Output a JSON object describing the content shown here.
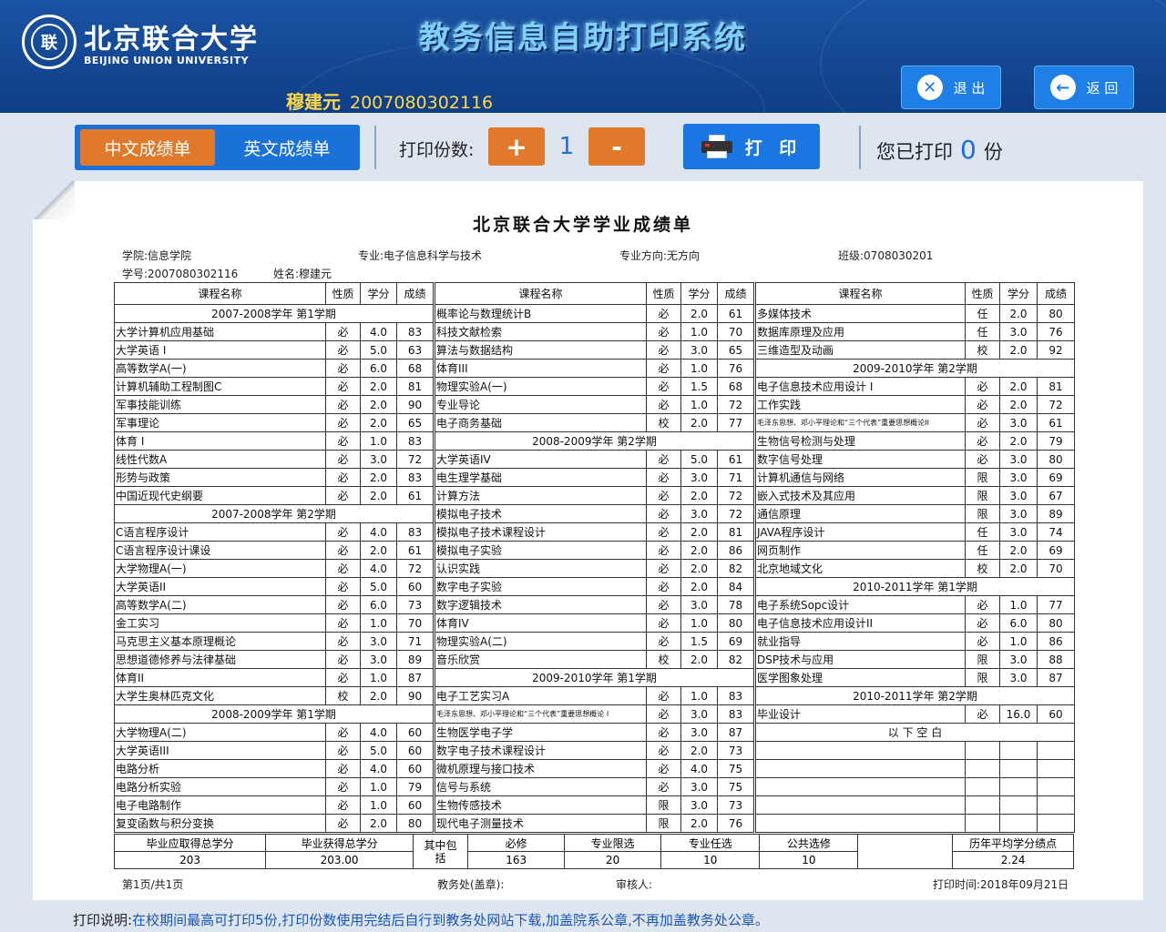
{
  "header": {
    "logo_cn": "北京联合大学",
    "logo_en": "BEIJING UNION UNIVERSITY",
    "system_title": "教务信息自助打印系统",
    "user_name": "穆建元",
    "user_id": "2007080302116",
    "exit_label": "退 出",
    "back_label": "返 回"
  },
  "toolbar": {
    "tab_cn": "中文成绩单",
    "tab_en": "英文成绩单",
    "copies_label": "打印份数:",
    "plus_label": "+",
    "minus_label": "-",
    "copies_value": "1",
    "print_label": "打 印",
    "printed_prefix": "您已打印",
    "printed_count": "0",
    "printed_suffix": "份"
  },
  "transcript": {
    "title": "北京联合大学学业成绩单",
    "college": "学院:信息学院",
    "major": "专业:电子信息科学与技术",
    "direction": "专业方向:无方向",
    "class": "班级:0708030201",
    "student_id": "学号:2007080302116",
    "name": "姓名:穆建元",
    "headers": [
      "课程名称",
      "性质",
      "学分",
      "成绩"
    ],
    "col1": [
      [
        "T",
        "2007-2008学年 第1学期"
      ],
      [
        "大学计算机应用基础",
        "必",
        "4.0",
        "83"
      ],
      [
        "大学英语 I",
        "必",
        "5.0",
        "63"
      ],
      [
        "高等数学A(一)",
        "必",
        "6.0",
        "68"
      ],
      [
        "计算机辅助工程制图C",
        "必",
        "2.0",
        "81"
      ],
      [
        "军事技能训练",
        "必",
        "2.0",
        "90"
      ],
      [
        "军事理论",
        "必",
        "2.0",
        "65"
      ],
      [
        "体育 I",
        "必",
        "1.0",
        "83"
      ],
      [
        "线性代数A",
        "必",
        "3.0",
        "72"
      ],
      [
        "形势与政策",
        "必",
        "2.0",
        "83"
      ],
      [
        "中国近现代史纲要",
        "必",
        "2.0",
        "61"
      ],
      [
        "T",
        "2007-2008学年 第2学期"
      ],
      [
        "C语言程序设计",
        "必",
        "4.0",
        "83"
      ],
      [
        "C语言程序设计课设",
        "必",
        "2.0",
        "61"
      ],
      [
        "大学物理A(一)",
        "必",
        "4.0",
        "72"
      ],
      [
        "大学英语II",
        "必",
        "5.0",
        "60"
      ],
      [
        "高等数学A(二)",
        "必",
        "6.0",
        "73"
      ],
      [
        "金工实习",
        "必",
        "1.0",
        "70"
      ],
      [
        "马克思主义基本原理概论",
        "必",
        "3.0",
        "71"
      ],
      [
        "思想道德修养与法律基础",
        "必",
        "3.0",
        "89"
      ],
      [
        "体育II",
        "必",
        "1.0",
        "87"
      ],
      [
        "大学生奥林匹克文化",
        "校",
        "2.0",
        "90"
      ],
      [
        "T",
        "2008-2009学年 第1学期"
      ],
      [
        "大学物理A(二)",
        "必",
        "4.0",
        "60"
      ],
      [
        "大学英语III",
        "必",
        "5.0",
        "60"
      ],
      [
        "电路分析",
        "必",
        "4.0",
        "60"
      ],
      [
        "电路分析实验",
        "必",
        "1.0",
        "79"
      ],
      [
        "电子电路制作",
        "必",
        "1.0",
        "60"
      ],
      [
        "复变函数与积分变换",
        "必",
        "2.0",
        "80"
      ]
    ],
    "col2": [
      [
        "概率论与数理统计B",
        "必",
        "2.0",
        "61"
      ],
      [
        "科技文献检索",
        "必",
        "1.0",
        "70"
      ],
      [
        "算法与数据结构",
        "必",
        "3.0",
        "65"
      ],
      [
        "体育III",
        "必",
        "1.0",
        "76"
      ],
      [
        "物理实验A(一)",
        "必",
        "1.5",
        "68"
      ],
      [
        "专业导论",
        "必",
        "1.0",
        "72"
      ],
      [
        "电子商务基础",
        "校",
        "2.0",
        "77"
      ],
      [
        "T",
        "2008-2009学年 第2学期"
      ],
      [
        "大学英语IV",
        "必",
        "5.0",
        "61"
      ],
      [
        "电生理学基础",
        "必",
        "3.0",
        "71"
      ],
      [
        "计算方法",
        "必",
        "2.0",
        "72"
      ],
      [
        "模拟电子技术",
        "必",
        "3.0",
        "72"
      ],
      [
        "模拟电子技术课程设计",
        "必",
        "2.0",
        "81"
      ],
      [
        "模拟电子实验",
        "必",
        "2.0",
        "86"
      ],
      [
        "认识实践",
        "必",
        "2.0",
        "82"
      ],
      [
        "数字电子实验",
        "必",
        "2.0",
        "84"
      ],
      [
        "数字逻辑技术",
        "必",
        "3.0",
        "78"
      ],
      [
        "体育IV",
        "必",
        "1.0",
        "80"
      ],
      [
        "物理实验A(二)",
        "必",
        "1.5",
        "69"
      ],
      [
        "音乐欣赏",
        "校",
        "2.0",
        "82"
      ],
      [
        "T",
        "2009-2010学年 第1学期"
      ],
      [
        "电子工艺实习A",
        "必",
        "1.0",
        "83"
      ],
      [
        "S",
        "毛泽东思想、邓小平理论和“三个代表”重要思想概论 I",
        "必",
        "3.0",
        "83"
      ],
      [
        "生物医学电子学",
        "必",
        "3.0",
        "87"
      ],
      [
        "数字电子技术课程设计",
        "必",
        "2.0",
        "73"
      ],
      [
        "微机原理与接口技术",
        "必",
        "4.0",
        "75"
      ],
      [
        "信号与系统",
        "必",
        "3.0",
        "75"
      ],
      [
        "生物传感技术",
        "限",
        "3.0",
        "73"
      ],
      [
        "现代电子测量技术",
        "限",
        "2.0",
        "76"
      ]
    ],
    "col3": [
      [
        "多媒体技术",
        "任",
        "2.0",
        "80"
      ],
      [
        "数据库原理及应用",
        "任",
        "3.0",
        "76"
      ],
      [
        "三维造型及动画",
        "校",
        "2.0",
        "92"
      ],
      [
        "T",
        "2009-2010学年 第2学期"
      ],
      [
        "电子信息技术应用设计 I",
        "必",
        "2.0",
        "81"
      ],
      [
        "工作实践",
        "必",
        "2.0",
        "72"
      ],
      [
        "S",
        "毛泽东思想、邓小平理论和“三个代表”重要思想概论II",
        "必",
        "3.0",
        "61"
      ],
      [
        "生物信号检测与处理",
        "必",
        "2.0",
        "79"
      ],
      [
        "数字信号处理",
        "必",
        "3.0",
        "80"
      ],
      [
        "计算机通信与网络",
        "限",
        "3.0",
        "69"
      ],
      [
        "嵌入式技术及其应用",
        "限",
        "3.0",
        "67"
      ],
      [
        "通信原理",
        "限",
        "3.0",
        "89"
      ],
      [
        "JAVA程序设计",
        "任",
        "3.0",
        "74"
      ],
      [
        "网页制作",
        "任",
        "2.0",
        "69"
      ],
      [
        "北京地域文化",
        "校",
        "2.0",
        "70"
      ],
      [
        "T",
        "2010-2011学年 第1学期"
      ],
      [
        "电子系统Sopc设计",
        "必",
        "1.0",
        "77"
      ],
      [
        "电子信息技术应用设计II",
        "必",
        "6.0",
        "80"
      ],
      [
        "就业指导",
        "必",
        "1.0",
        "86"
      ],
      [
        "DSP技术与应用",
        "限",
        "3.0",
        "88"
      ],
      [
        "医学图象处理",
        "限",
        "3.0",
        "87"
      ],
      [
        "T",
        "2010-2011学年 第2学期"
      ],
      [
        "毕业设计",
        "必",
        "16.0",
        "60"
      ],
      [
        "T",
        "以 下 空 白"
      ],
      [
        "",
        "",
        "",
        ""
      ],
      [
        "",
        "",
        "",
        ""
      ],
      [
        "",
        "",
        "",
        ""
      ],
      [
        "",
        "",
        "",
        ""
      ],
      [
        "",
        "",
        "",
        ""
      ]
    ],
    "summary": {
      "required_label": "毕业应取得总学分",
      "required_value": "203",
      "earned_label": "毕业获得总学分",
      "earned_value": "203.00",
      "among_label": "其中包括",
      "bixiu_label": "必修",
      "bixiu_value": "163",
      "zhuanye_xian_label": "专业限选",
      "zhuanye_xian_value": "20",
      "zhuanye_ren_label": "专业任选",
      "zhuanye_ren_value": "10",
      "gonggong_label": "公共选修",
      "gonggong_value": "10",
      "gpa_label": "历年平均学分绩点",
      "gpa_value": "2.24"
    },
    "footer": {
      "page": "第1页/共1页",
      "stamp": "教务处(盖章):",
      "reviewer": "审核人:",
      "print_time": "打印时间:2018年09月21日"
    }
  },
  "note": {
    "label": "打印说明:",
    "text": "在校期间最高可打印5份,打印份数使用完结后自行到教务处网站下载,加盖院系公章,不再加盖教务处公章。"
  }
}
